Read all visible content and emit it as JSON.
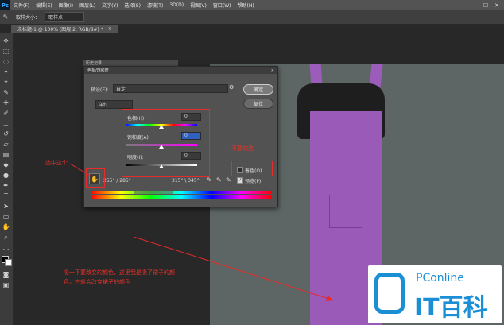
{
  "menu": {
    "logo": "Ps",
    "items": [
      "文件(F)",
      "编辑(E)",
      "图像(I)",
      "图层(L)",
      "文字(Y)",
      "选择(S)",
      "滤镜(T)",
      "3D(D)",
      "视图(V)",
      "窗口(W)",
      "帮助(H)"
    ],
    "window_buttons": [
      "—",
      "☐",
      "✕"
    ]
  },
  "options": {
    "label": "取样大小：",
    "value": "取样点"
  },
  "document": {
    "tab": "未标题-1 @ 100% (图层 2, RGB/8#) *",
    "tab_close": "×"
  },
  "history_panel": {
    "title": "历史记录"
  },
  "dialog": {
    "title": "色相/饱和度",
    "close": "×",
    "preset_label": "预设(E):",
    "preset_value": "自定",
    "channel_value": "洋红",
    "hue_label": "色相(H):",
    "hue_value": "0",
    "saturation_label": "饱和度(A):",
    "saturation_value": "0",
    "lightness_label": "明度(I):",
    "lightness_value": "0",
    "ok_label": "确定",
    "reset_label": "复位",
    "colorize_label": "着色(O)",
    "preview_label": "预览(P)",
    "range_left": "255° / 285°",
    "range_right": "315° \\ 345°",
    "hand_icon": "hand-icon",
    "hue_fraction": 0.5,
    "saturation_fraction": 0.5,
    "lightness_fraction": 0.5
  },
  "annotations": {
    "select_label": "选中这个",
    "uncheck_label": "不要勾选",
    "instruction_line1": "吸一下要改变的颜色，这里我是吸了裙子的颜",
    "instruction_line2": "色，它就会改变裙子的颜色"
  },
  "watermark": {
    "brand_small": "PConline",
    "brand_large": "IT百科"
  },
  "colors": {
    "annotation_red": "#e52b2b",
    "overall_purple": "#9a5ab8",
    "watermark_blue": "#1a8fd6"
  }
}
